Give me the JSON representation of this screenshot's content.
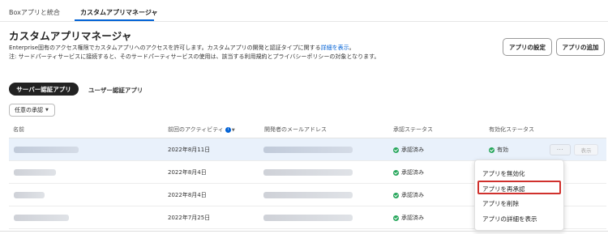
{
  "tabs": [
    {
      "label": "Boxアプリと統合"
    },
    {
      "label": "カスタムアプリマネージャ"
    }
  ],
  "page": {
    "title": "カスタムアプリマネージャ",
    "description_1": "Enterprise固有のアクセス権限でカスタムアプリへのアクセスを許可します。カスタムアプリの開発と認証タイプに関する",
    "description_link": "詳細を表示",
    "description_1_end": "。",
    "description_2": "注: サードパーティサービスに接続すると、そのサードパーティサービスの使用は、該当する利用規約とプライバシーポリシーの対象となります。"
  },
  "buttons": {
    "settings": "アプリの設定",
    "add": "アプリの追加"
  },
  "segments": {
    "server": "サーバー認証アプリ",
    "user": "ユーザー認証アプリ"
  },
  "filter": {
    "label": "任意の承認"
  },
  "columns": {
    "name": "名前",
    "last_activity": "前回のアクティビティ",
    "dev_email": "開発者のメールアドレス",
    "approval": "承認ステータス",
    "enable": "有効化ステータス"
  },
  "rows": [
    {
      "date": "2022年8月11日",
      "approval": "承認済み",
      "enable": "有効",
      "more": "···",
      "show": "表示"
    },
    {
      "date": "2022年8月4日",
      "approval": "承認済み"
    },
    {
      "date": "2022年8月4日",
      "approval": "承認済み"
    },
    {
      "date": "2022年7月25日",
      "approval": "承認済み"
    }
  ],
  "menu": {
    "items": [
      "アプリを無効化",
      "アプリを再承認",
      "アプリを削除",
      "アプリの詳細を表示"
    ]
  },
  "icons": {
    "info": "info-icon",
    "check": "check-circle-icon",
    "caret": "chevron-down-icon"
  },
  "colors": {
    "accent": "#0061d5",
    "success": "#26a65b",
    "highlight_box": "#d0312d",
    "row_highlight": "#e9f1fb"
  }
}
